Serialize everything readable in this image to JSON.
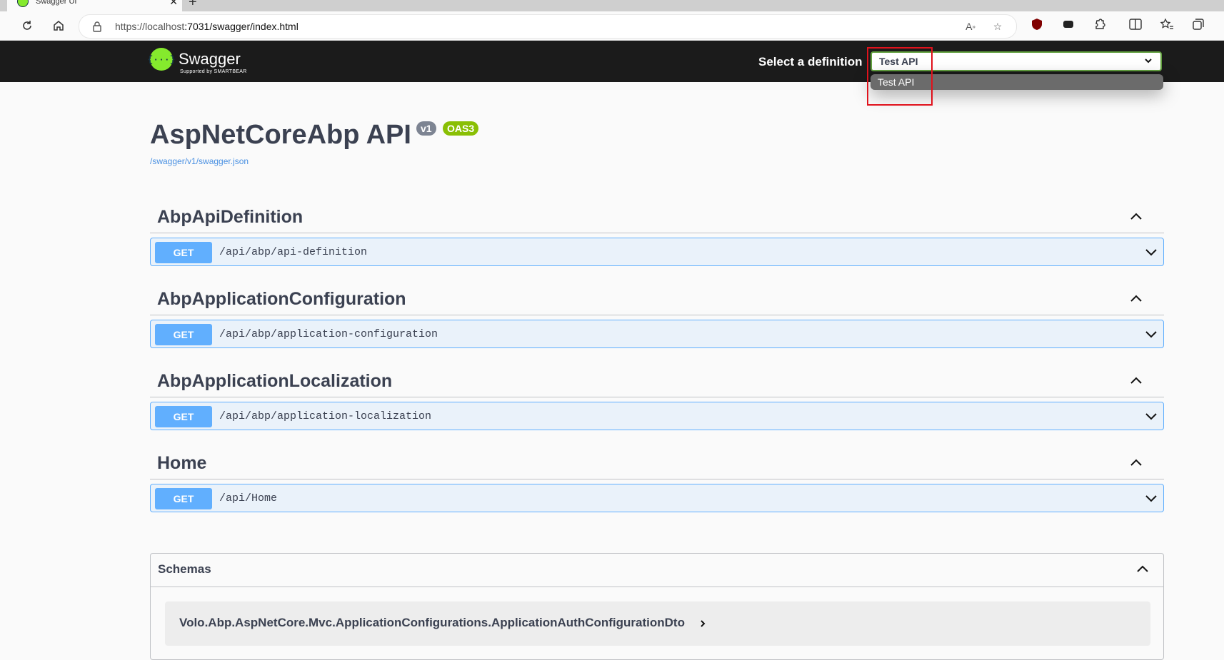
{
  "browser": {
    "tab_title": "Swagger UI",
    "url_host": "https://localhost",
    "url_rest": ":7031/swagger/index.html"
  },
  "topbar": {
    "logo_text": "Swagger",
    "logo_sub": "Supported by SMARTBEAR",
    "definition_label": "Select a definition",
    "definition_value": "Test API",
    "dropdown_options": [
      "Test API"
    ]
  },
  "info": {
    "title": "AspNetCoreAbp API",
    "version_badge": "v1",
    "oas_badge": "OAS3",
    "spec_link": "/swagger/v1/swagger.json"
  },
  "tags": [
    {
      "name": "AbpApiDefinition",
      "ops": [
        {
          "method": "GET",
          "path": "/api/abp/api-definition"
        }
      ]
    },
    {
      "name": "AbpApplicationConfiguration",
      "ops": [
        {
          "method": "GET",
          "path": "/api/abp/application-configuration"
        }
      ]
    },
    {
      "name": "AbpApplicationLocalization",
      "ops": [
        {
          "method": "GET",
          "path": "/api/abp/application-localization"
        }
      ]
    },
    {
      "name": "Home",
      "ops": [
        {
          "method": "GET",
          "path": "/api/Home"
        }
      ]
    }
  ],
  "schemas": {
    "title": "Schemas",
    "models": [
      "Volo.Abp.AspNetCore.Mvc.ApplicationConfigurations.ApplicationAuthConfigurationDto"
    ]
  },
  "colors": {
    "get": "#61affe",
    "topbar": "#1b1b1b",
    "logo": "#85ea2d",
    "oas_badge": "#89bf04",
    "highlight": "#e0121c"
  }
}
